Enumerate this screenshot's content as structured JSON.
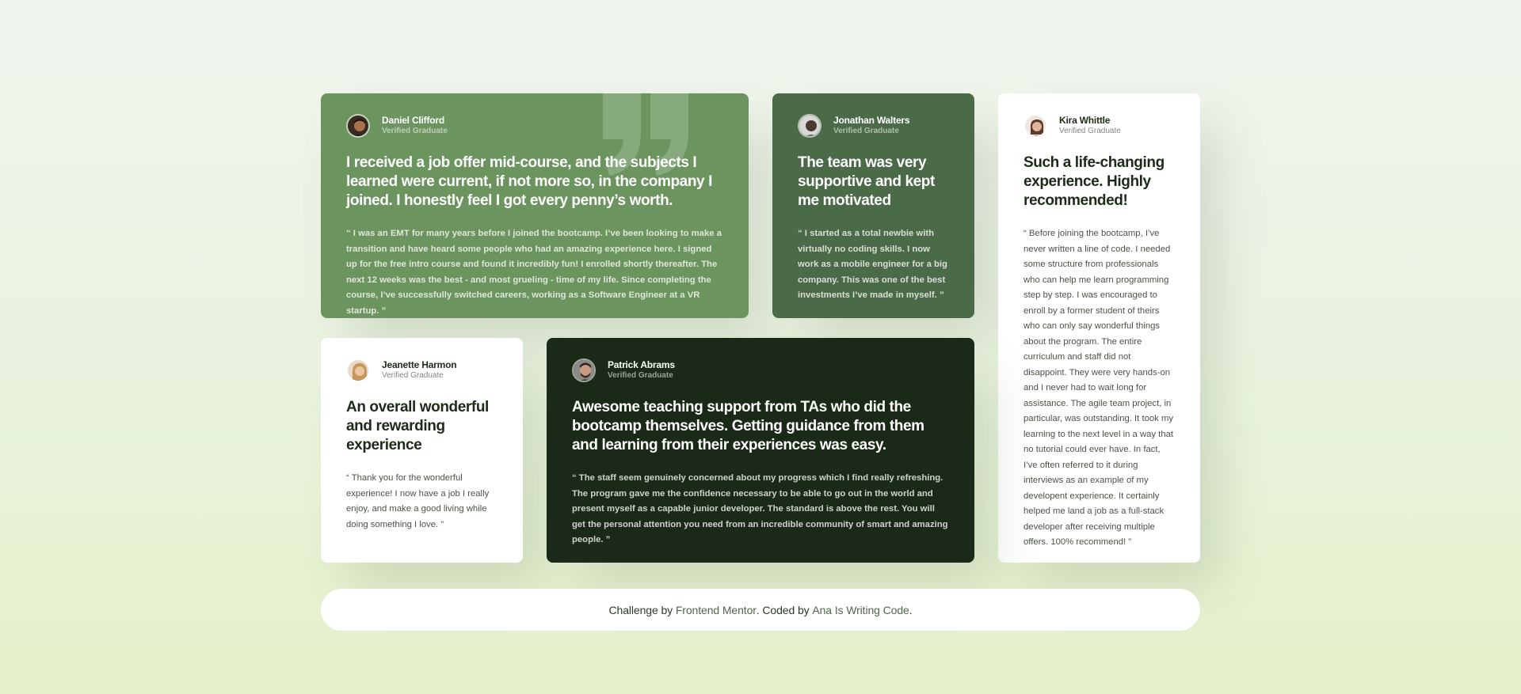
{
  "testimonials": [
    {
      "name": "Daniel Clifford",
      "role": "Verified Graduate",
      "headline": "I received a job offer mid-course, and the subjects I learned were current, if not more so, in the company I joined. I honestly feel I got every penny’s worth.",
      "body": "“ I was an EMT for many years before I joined the bootcamp. I’ve been looking to make a transition and have heard some people who had an amazing experience here. I signed up for the free intro course and found it incredibly fun! I enrolled shortly thereafter. The next 12 weeks was the best - and most grueling - time of my life. Since completing the course, I’ve successfully switched careers, working as a Software Engineer at a VR startup. ”"
    },
    {
      "name": "Jonathan Walters",
      "role": "Verified Graduate",
      "headline": "The team was very supportive and kept me motivated",
      "body": "“ I started as a total newbie with virtually no coding skills. I now work as a mobile engineer for a big company. This was one of the best investments I’ve made in myself. ”"
    },
    {
      "name": "Kira Whittle",
      "role": "Verified Graduate",
      "headline": "Such a life-changing experience. Highly recommended!",
      "body": "“ Before joining the bootcamp, I’ve never written a line of code. I needed some structure from professionals who can help me learn programming step by step. I was encouraged to enroll by a former student of theirs who can only say wonderful things about the program. The entire curriculum and staff did not disappoint. They were very hands-on and I never had to wait long for assistance. The agile team project, in particular, was outstanding. It took my learning to the next level in a way that no tutorial could ever have. In fact, I’ve often referred to it during interviews as an example of my developent experience. It certainly helped me land a job as a full-stack developer after receiving multiple offers. 100% recommend! ”"
    },
    {
      "name": "Jeanette Harmon",
      "role": "Verified Graduate",
      "headline": "An overall wonderful and rewarding experience",
      "body": "“ Thank you for the wonderful experience! I now have a job I really enjoy, and make a good living while doing something I love. ”"
    },
    {
      "name": "Patrick Abrams",
      "role": "Verified Graduate",
      "headline": "Awesome teaching support from TAs who did the bootcamp themselves. Getting guidance from them and learning from their experiences was easy.",
      "body": "“ The staff seem genuinely concerned about my progress which I find really refreshing. The program gave me the confidence necessary to be able to go out in the world and present myself as a capable junior developer. The standard is above the rest. You will get the personal attention you need from an incredible community of smart and amazing people. ”"
    }
  ],
  "footer": {
    "prefix": "Challenge by ",
    "link1": "Frontend Mentor",
    "middle": ". Coded by ",
    "link2": "Ana Is Writing Code",
    "suffix": "."
  },
  "colors": {
    "card1": "#6b945f",
    "card2": "#4b6a47",
    "card5": "#1b2918",
    "light_card": "#ffffff"
  }
}
